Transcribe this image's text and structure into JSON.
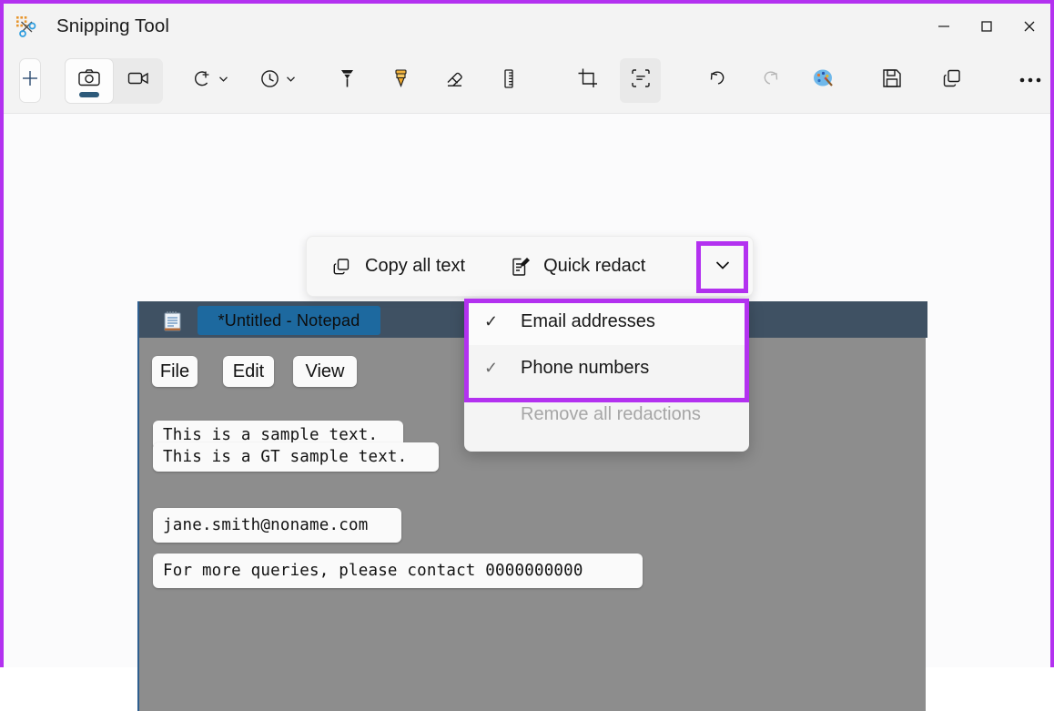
{
  "window": {
    "app_title": "Snipping Tool",
    "logo_icon": "snipping-tool-icon",
    "controls": {
      "minimize": "minimize-icon",
      "maximize": "maximize-icon",
      "close": "close-icon"
    },
    "accent_highlight_color": "#b331f0"
  },
  "toolbar": {
    "new_label": "new-snip-icon",
    "mode_screenshot": "camera-icon",
    "mode_video": "video-camera-icon",
    "shapes": "shapes-icon",
    "shapes_caret": "chevron-down-icon",
    "delay": "clock-icon",
    "delay_caret": "chevron-down-icon",
    "pen": "ballpoint-pen-icon",
    "highlighter": "highlighter-icon",
    "eraser": "eraser-icon",
    "ruler": "ruler-icon",
    "crop": "crop-icon",
    "text_actions": "text-actions-icon",
    "undo": "undo-icon",
    "redo": "redo-icon",
    "paint": "paint-palette-icon",
    "save": "save-icon",
    "copy": "copy-icon",
    "more": "more-options-icon"
  },
  "flyout": {
    "copy_all_text": {
      "label": "Copy all text",
      "icon": "copy-icon"
    },
    "quick_redact": {
      "label": "Quick redact",
      "icon": "redact-edit-icon"
    },
    "caret": "chevron-down-icon"
  },
  "dropdown": {
    "items": [
      {
        "label": "Email addresses",
        "checked": true,
        "check_glyph": "✓",
        "state": "hover"
      },
      {
        "label": "Phone numbers",
        "checked": true,
        "check_glyph": "✓",
        "state": "normal"
      },
      {
        "label": "Remove all redactions",
        "checked": false,
        "check_glyph": "",
        "state": "disabled"
      }
    ]
  },
  "capture": {
    "notepad_title": "*Untitled - Notepad",
    "notepad_icon": "notepad-icon",
    "menu_items": [
      "File",
      "Edit",
      "View"
    ],
    "text_blocks": [
      "This is a sample text.",
      "This is a GT sample text.",
      "jane.smith@noname.com",
      "For more queries, please contact 0000000000"
    ],
    "titlebar_color": "#3f5163",
    "body_color": "#8d8d8d",
    "title_highlight_color": "#1d699f"
  }
}
